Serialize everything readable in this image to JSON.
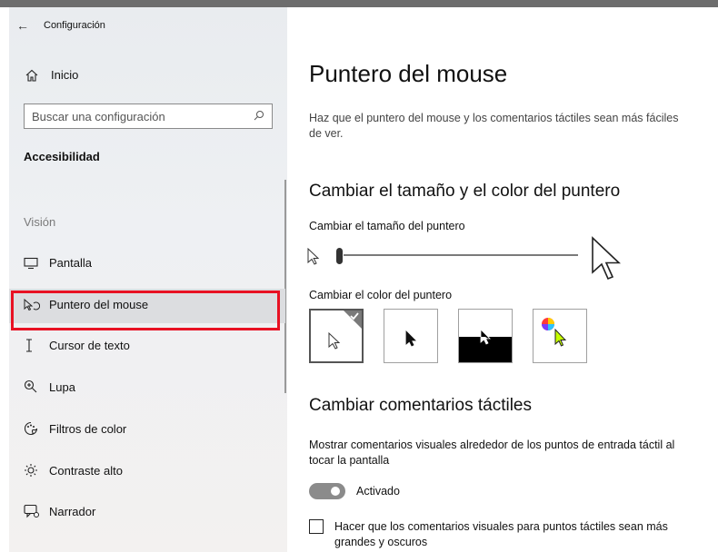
{
  "window": {
    "title": "Configuración"
  },
  "sidebar": {
    "home_label": "Inicio",
    "search_placeholder": "Buscar una configuración",
    "section_title": "Accesibilidad",
    "group_label": "Visión",
    "items": [
      {
        "label": "Pantalla",
        "icon": "monitor-icon"
      },
      {
        "label": "Puntero del mouse",
        "icon": "mouse-pointer-icon",
        "selected": true
      },
      {
        "label": "Cursor de texto",
        "icon": "text-cursor-icon"
      },
      {
        "label": "Lupa",
        "icon": "magnifier-icon"
      },
      {
        "label": "Filtros de color",
        "icon": "color-filter-icon"
      },
      {
        "label": "Contraste alto",
        "icon": "high-contrast-icon"
      },
      {
        "label": "Narrador",
        "icon": "narrator-icon"
      }
    ]
  },
  "main": {
    "title": "Puntero del mouse",
    "description": "Haz que el puntero del mouse y los comentarios táctiles sean más fáciles de ver.",
    "size_color_section": {
      "heading": "Cambiar el tamaño y el color del puntero",
      "size_label": "Cambiar el tamaño del puntero",
      "size_level": 0.05,
      "color_label": "Cambiar el color del puntero",
      "color_options": [
        {
          "name": "white",
          "selected": true
        },
        {
          "name": "black",
          "selected": false
        },
        {
          "name": "inverted",
          "selected": false
        },
        {
          "name": "custom",
          "selected": false
        }
      ]
    },
    "touch_section": {
      "heading": "Cambiar comentarios táctiles",
      "show_label": "Mostrar comentarios visuales alrededor de los puntos de entrada táctil al tocar la pantalla",
      "toggle_state": "Activado",
      "toggle_on": true,
      "darker_label": "Hacer que los comentarios visuales para puntos táctiles sean más grandes y oscuros",
      "darker_checked": false
    }
  },
  "colors": {
    "selection_highlight": "#e81123",
    "accent_green": "#c6ff00"
  }
}
